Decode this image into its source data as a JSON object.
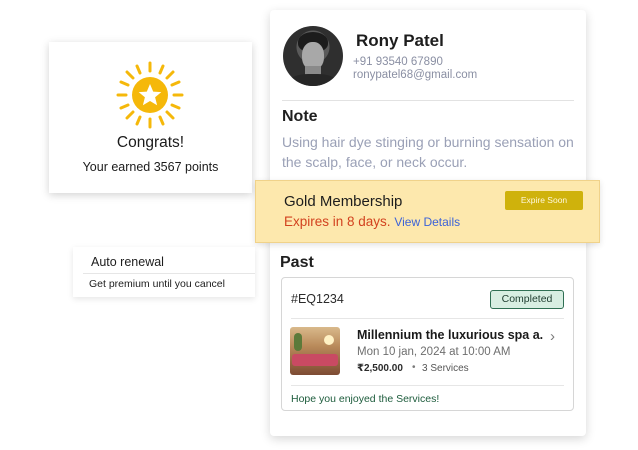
{
  "profile": {
    "name": "Rony Patel",
    "phone": "+91 93540 67890",
    "email": "ronypatel68@gmail.com"
  },
  "note": {
    "title": "Note",
    "text": "Using hair dye stinging or burning sensation on the scalp, face, or neck occur."
  },
  "congrats": {
    "title": "Congrats!",
    "subtitle": "Your earned 3567 points",
    "icon": "sun-star-icon",
    "accent_color": "#f5b80a"
  },
  "membership": {
    "title": "Gold Membership",
    "expires_text": "Expires in 8 days.",
    "link_label": "View Details",
    "badge": "Expire Soon",
    "background_color": "#fde8ad",
    "badge_color": "#cfb20c"
  },
  "auto_renewal": {
    "title": "Auto renewal",
    "subtitle": "Get premium until you cancel"
  },
  "past": {
    "title": "Past",
    "booking": {
      "id": "#EQ1234",
      "status": "Completed",
      "name": "Millennium the luxurious spa a...",
      "datetime": "Mon 10 jan, 2024 at 10:00 AM",
      "price": "₹2,500.00",
      "separator": "•",
      "services": "3 Services",
      "message": "Hope you enjoyed the Services!"
    }
  }
}
